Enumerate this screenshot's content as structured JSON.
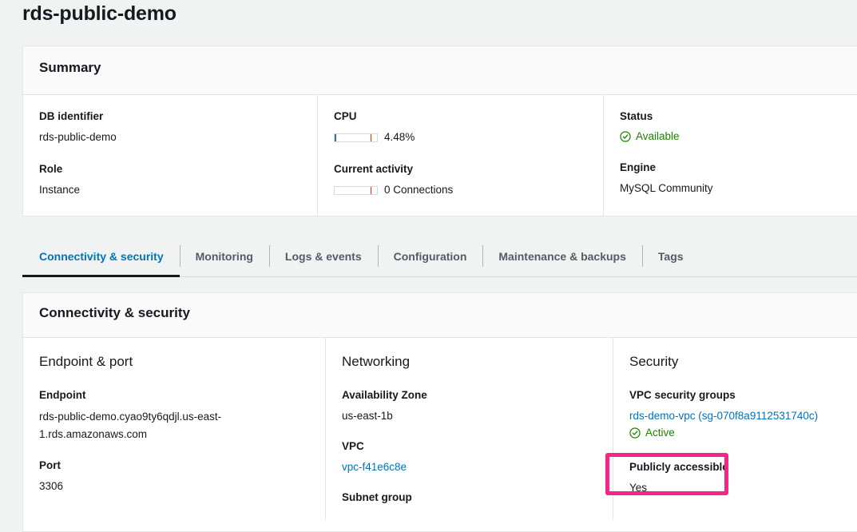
{
  "page": {
    "title": "rds-public-demo"
  },
  "summary": {
    "header": "Summary",
    "db_identifier": {
      "label": "DB identifier",
      "value": "rds-public-demo"
    },
    "role": {
      "label": "Role",
      "value": "Instance"
    },
    "cpu": {
      "label": "CPU",
      "value": "4.48%",
      "percent": 4.48,
      "threshold_percent": 85
    },
    "current_activity": {
      "label": "Current activity",
      "value": "0 Connections",
      "percent": 0,
      "threshold_percent": 85
    },
    "status": {
      "label": "Status",
      "value": "Available",
      "icon": "check-circle-icon",
      "color": "#1d8102"
    },
    "engine": {
      "label": "Engine",
      "value": "MySQL Community"
    }
  },
  "tabs": [
    {
      "label": "Connectivity & security",
      "active": true
    },
    {
      "label": "Monitoring",
      "active": false
    },
    {
      "label": "Logs & events",
      "active": false
    },
    {
      "label": "Configuration",
      "active": false
    },
    {
      "label": "Maintenance & backups",
      "active": false
    },
    {
      "label": "Tags",
      "active": false
    }
  ],
  "connectivity": {
    "header": "Connectivity & security",
    "endpoint_port": {
      "title": "Endpoint & port",
      "endpoint": {
        "label": "Endpoint",
        "value": "rds-public-demo.cyao9ty6qdjl.us-east-1.rds.amazonaws.com"
      },
      "port": {
        "label": "Port",
        "value": "3306"
      }
    },
    "networking": {
      "title": "Networking",
      "availability_zone": {
        "label": "Availability Zone",
        "value": "us-east-1b"
      },
      "vpc": {
        "label": "VPC",
        "value": "vpc-f41e6c8e"
      },
      "subnet_group": {
        "label": "Subnet group"
      }
    },
    "security": {
      "title": "Security",
      "vpc_security_groups": {
        "label": "VPC security groups",
        "value": "rds-demo-vpc (sg-070f8a9112531740c)",
        "state": "Active",
        "state_icon": "check-circle-icon"
      },
      "publicly_accessible": {
        "label": "Publicly accessible",
        "value": "Yes"
      }
    }
  },
  "annotation": {
    "highlight_color": "#f72585"
  }
}
